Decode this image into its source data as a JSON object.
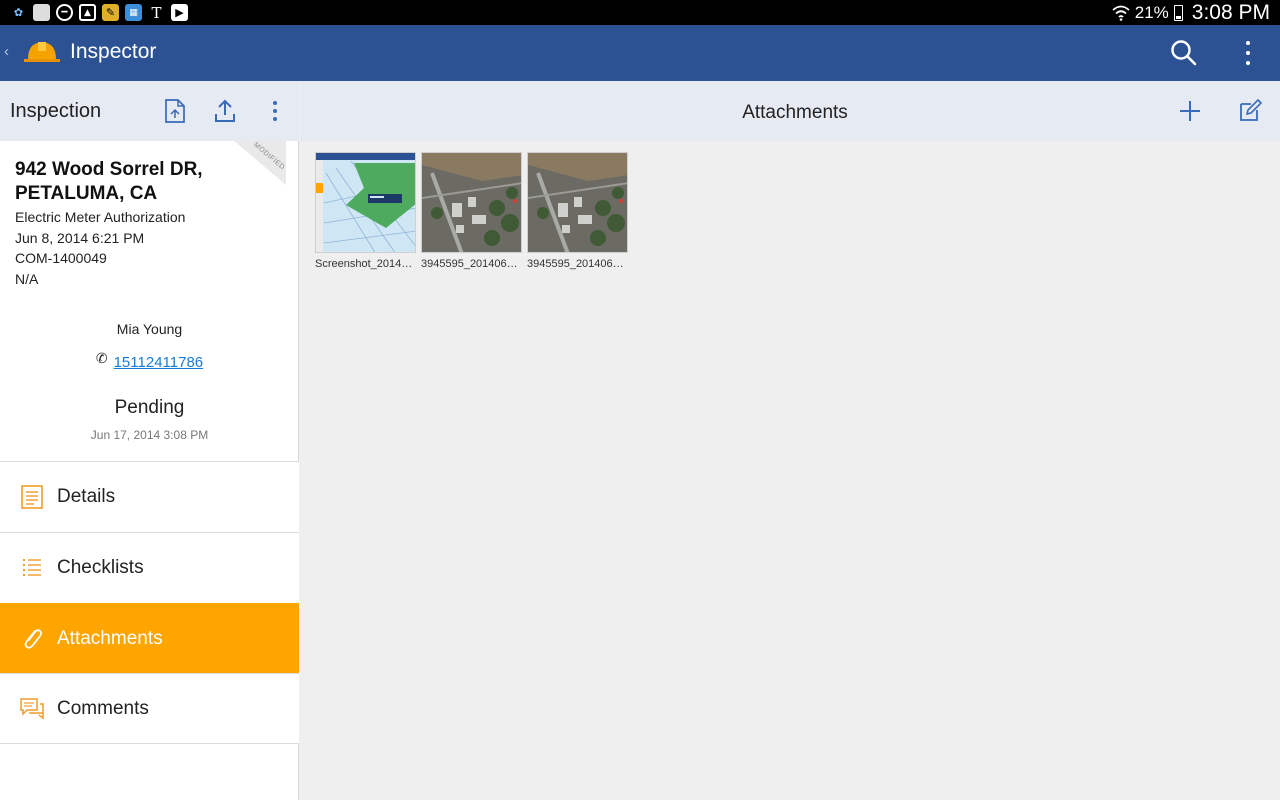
{
  "status_bar": {
    "battery": "21%",
    "time": "3:08 PM"
  },
  "action_bar": {
    "back": "‹",
    "title": "Inspector"
  },
  "left_panel": {
    "header_title": "Inspection",
    "ribbon": "MODIFIED",
    "address_line1": "942 Wood Sorrel DR,",
    "address_line2": "PETALUMA, CA",
    "type": "Electric Meter Authorization",
    "date": "Jun 8, 2014 6:21 PM",
    "record_id": "COM-1400049",
    "extra": "N/A",
    "contact_name": "Mia Young",
    "phone": "15112411786",
    "status": "Pending",
    "status_date": "Jun 17, 2014 3:08 PM",
    "menu": [
      {
        "label": "Details",
        "icon": "details-icon",
        "active": false
      },
      {
        "label": "Checklists",
        "icon": "checklist-icon",
        "active": false
      },
      {
        "label": "Attachments",
        "icon": "paperclip-icon",
        "active": true
      },
      {
        "label": "Comments",
        "icon": "comments-icon",
        "active": false
      }
    ]
  },
  "main": {
    "title": "Attachments",
    "attachments": [
      {
        "caption": "Screenshot_2014…"
      },
      {
        "caption": "3945595_201406…"
      },
      {
        "caption": "3945595_201406…"
      }
    ]
  },
  "colors": {
    "action_bar": "#2d5293",
    "panel_header": "#e6eaf2",
    "accent": "#fea500",
    "link": "#1a7bd6"
  }
}
